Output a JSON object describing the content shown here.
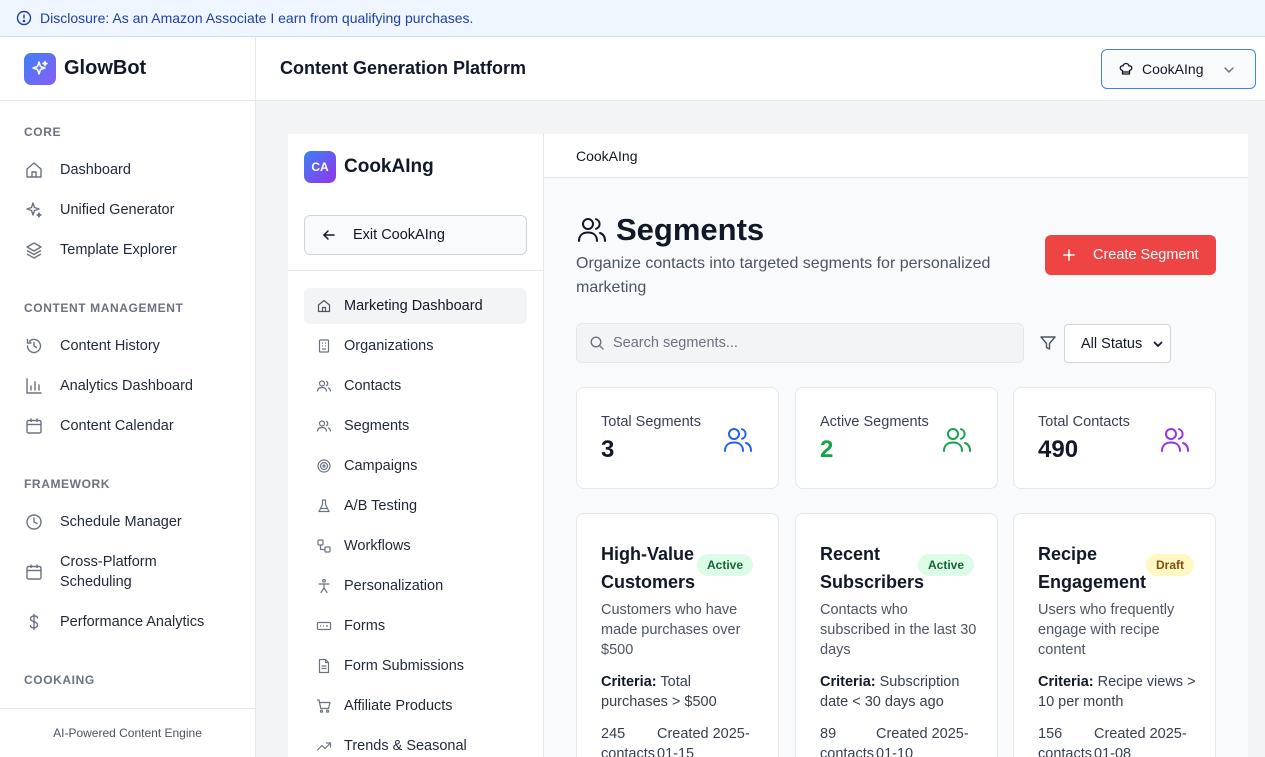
{
  "disclosure": {
    "text": "Disclosure: As an Amazon Associate I earn from qualifying purchases."
  },
  "app": {
    "name": "GlowBot",
    "footer": "AI-Powered Content Engine"
  },
  "sidebar": {
    "sections": [
      {
        "label": "CORE"
      },
      {
        "label": "CONTENT MANAGEMENT"
      },
      {
        "label": "FRAMEWORK"
      },
      {
        "label": "COOKAING"
      }
    ],
    "items": [
      {
        "label": "Dashboard",
        "icon": "home-icon"
      },
      {
        "label": "Unified Generator",
        "icon": "sparkles-icon"
      },
      {
        "label": "Template Explorer",
        "icon": "layers-icon"
      },
      {
        "label": "Content History",
        "icon": "history-icon"
      },
      {
        "label": "Analytics Dashboard",
        "icon": "bar-chart-icon"
      },
      {
        "label": "Content Calendar",
        "icon": "calendar-icon"
      },
      {
        "label": "Schedule Manager",
        "icon": "clock-icon"
      },
      {
        "label": "Cross-Platform Scheduling",
        "icon": "calendar-icon"
      },
      {
        "label": "Performance Analytics",
        "icon": "dollar-icon"
      }
    ]
  },
  "header": {
    "title": "Content Generation Platform",
    "brand_selector": "CookAIng"
  },
  "cookaing": {
    "badge": "CA",
    "name": "CookAIng",
    "exit_label": "Exit CookAIng",
    "nav": [
      {
        "label": "Marketing Dashboard",
        "icon": "home-icon"
      },
      {
        "label": "Organizations",
        "icon": "building-icon"
      },
      {
        "label": "Contacts",
        "icon": "users-icon"
      },
      {
        "label": "Segments",
        "icon": "users-icon"
      },
      {
        "label": "Campaigns",
        "icon": "target-icon"
      },
      {
        "label": "A/B Testing",
        "icon": "flask-icon"
      },
      {
        "label": "Workflows",
        "icon": "workflow-icon"
      },
      {
        "label": "Personalization",
        "icon": "person-icon"
      },
      {
        "label": "Forms",
        "icon": "form-icon"
      },
      {
        "label": "Form Submissions",
        "icon": "file-icon"
      },
      {
        "label": "Affiliate Products",
        "icon": "cart-icon"
      },
      {
        "label": "Trends & Seasonal",
        "icon": "trending-icon"
      }
    ]
  },
  "breadcrumb": "CookAIng",
  "page": {
    "title": "Segments",
    "subtitle": "Organize contacts into targeted segments for personalized marketing",
    "create_label": "Create Segment",
    "search_placeholder": "Search segments...",
    "status_filter": "All Status"
  },
  "stats": [
    {
      "label": "Total Segments",
      "value": "3",
      "color": "#2563eb"
    },
    {
      "label": "Active Segments",
      "value": "2",
      "color": "#16a34a"
    },
    {
      "label": "Total Contacts",
      "value": "490",
      "color": "#9333ea"
    }
  ],
  "segments": [
    {
      "name": "High-Value Customers",
      "status": "Active",
      "description": "Customers who have made purchases over $500",
      "criteria_label": "Criteria:",
      "criteria": "Total purchases > $500",
      "contacts": "245 contacts",
      "created": "Created 2025-01-15"
    },
    {
      "name": "Recent Subscribers",
      "status": "Active",
      "description": "Contacts who subscribed in the last 30 days",
      "criteria_label": "Criteria:",
      "criteria": "Subscription date < 30 days ago",
      "contacts": "89 contacts",
      "created": "Created 2025-01-10"
    },
    {
      "name": "Recipe Engagement",
      "status": "Draft",
      "description": "Users who frequently engage with recipe content",
      "criteria_label": "Criteria:",
      "criteria": "Recipe views > 10 per month",
      "contacts": "156 contacts",
      "created": "Created 2025-01-08"
    }
  ],
  "colors": {
    "accent": "#ef4444",
    "brand_gradient_start": "#3b82f6",
    "brand_gradient_end": "#8b5cf6"
  }
}
